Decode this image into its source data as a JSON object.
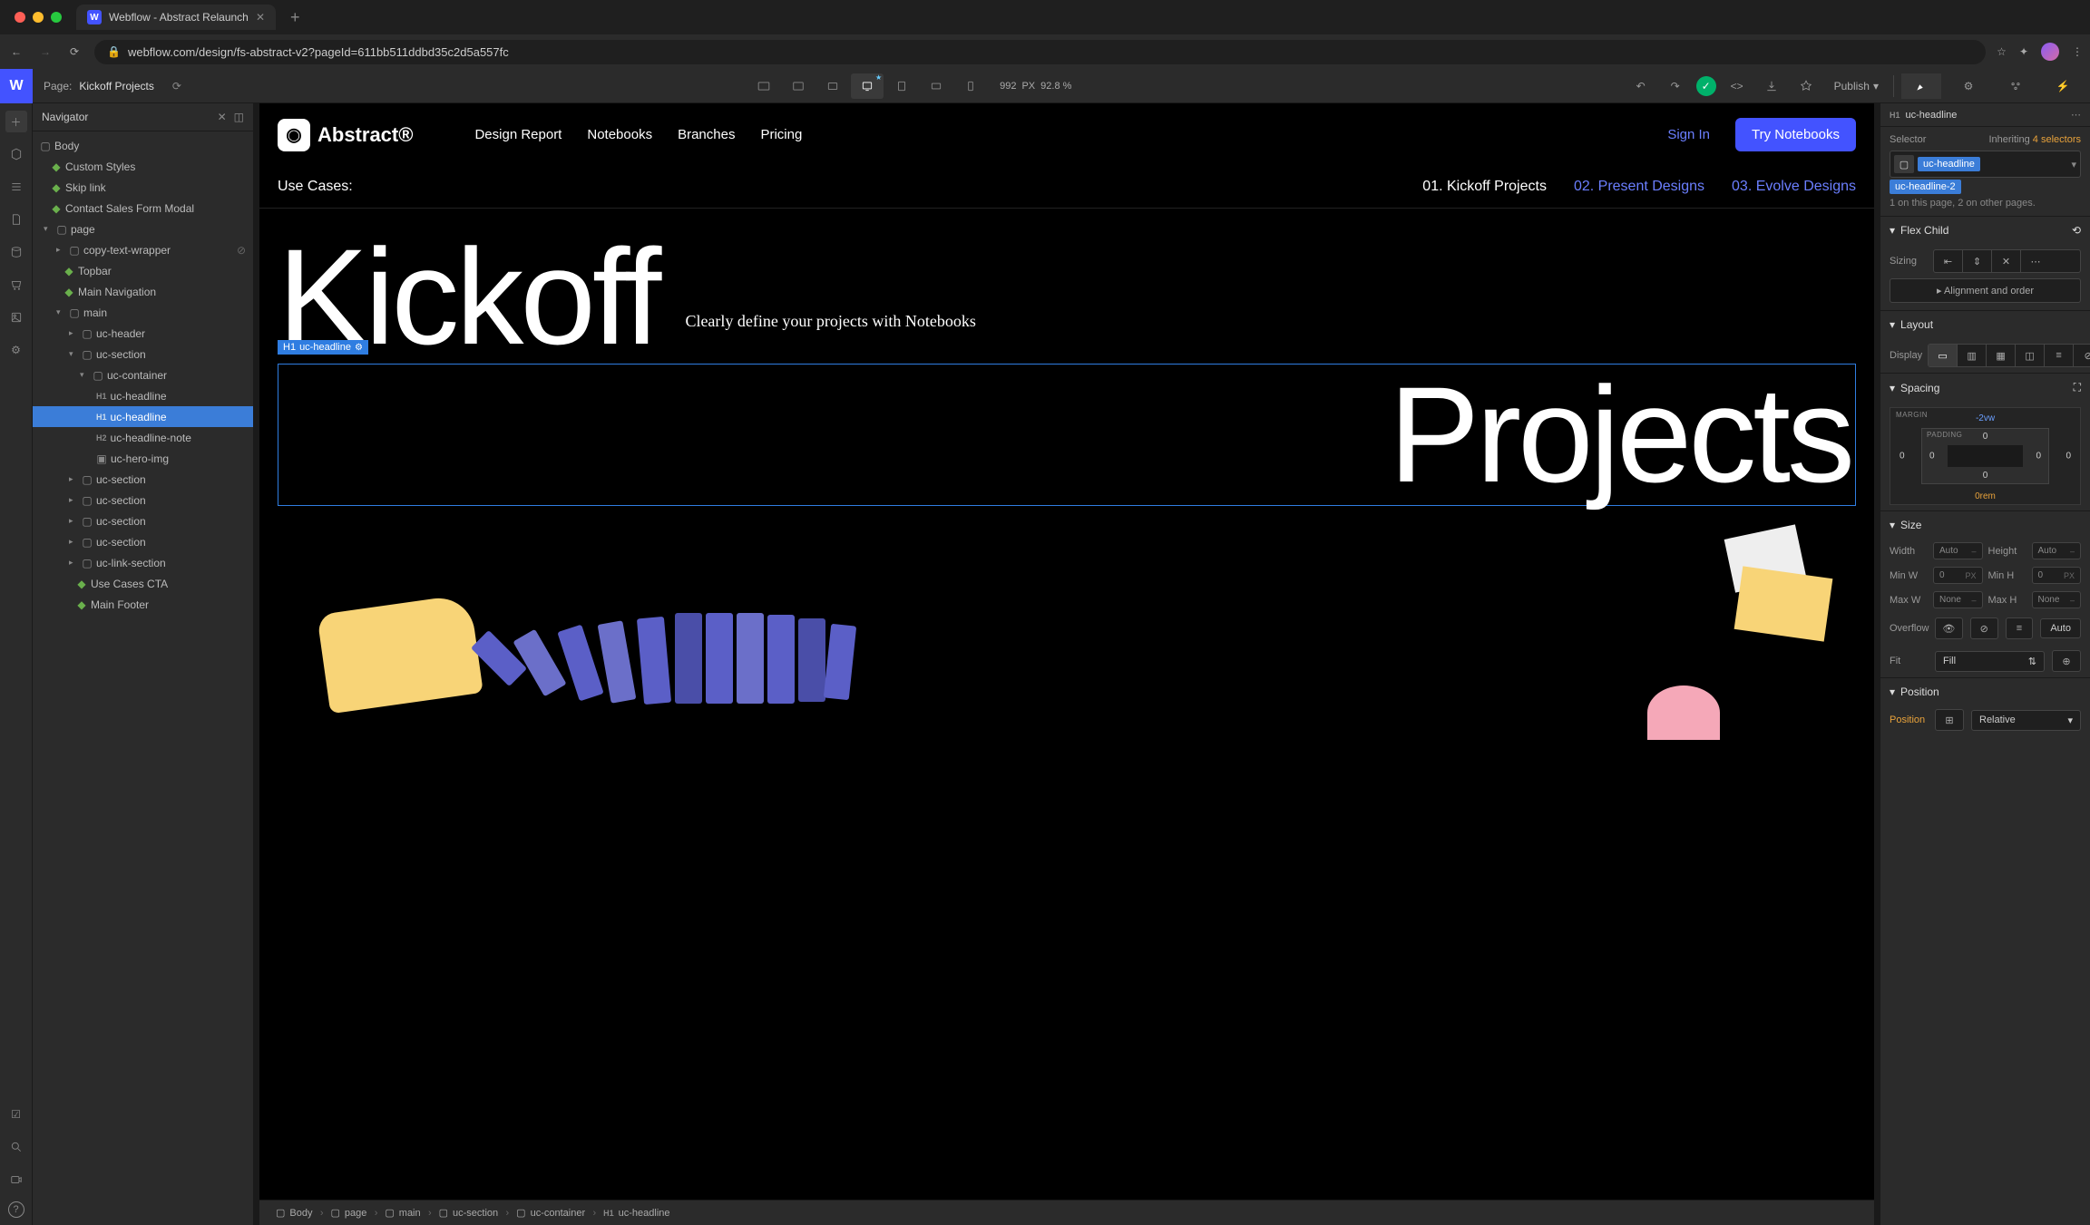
{
  "browser": {
    "tab_title": "Webflow - Abstract Relaunch",
    "url": "webflow.com/design/fs-abstract-v2?pageId=611bb511ddbd35c2d5a557fc"
  },
  "toolbar": {
    "page_prefix": "Page:",
    "page_name": "Kickoff Projects",
    "viewport_px": "992",
    "viewport_unit": "PX",
    "zoom": "92.8 %",
    "publish": "Publish"
  },
  "navigator": {
    "title": "Navigator",
    "tree": {
      "body": "Body",
      "custom_styles": "Custom Styles",
      "skip_link": "Skip link",
      "contact_modal": "Contact Sales Form Modal",
      "page": "page",
      "copy_text_wrapper": "copy-text-wrapper",
      "topbar": "Topbar",
      "main_nav": "Main Navigation",
      "main": "main",
      "uc_header": "uc-header",
      "uc_section": "uc-section",
      "uc_container": "uc-container",
      "uc_headline_1": "uc-headline",
      "uc_headline_2": "uc-headline",
      "uc_headline_note": "uc-headline-note",
      "uc_hero_img": "uc-hero-img",
      "uc_section_2": "uc-section",
      "uc_section_3": "uc-section",
      "uc_section_4": "uc-section",
      "uc_section_5": "uc-section",
      "uc_link_section": "uc-link-section",
      "use_cases_cta": "Use Cases CTA",
      "main_footer": "Main Footer"
    }
  },
  "preview": {
    "brand": "Abstract®",
    "nav": {
      "design_report": "Design Report",
      "notebooks": "Notebooks",
      "branches": "Branches",
      "pricing": "Pricing",
      "signin": "Sign In",
      "cta": "Try Notebooks"
    },
    "uc": {
      "label": "Use Cases:",
      "i1": "01. Kickoff Projects",
      "i2": "02. Present Designs",
      "i3": "03. Evolve Designs"
    },
    "headline1": "Kickoff",
    "subtitle": "Clearly define your projects with Notebooks",
    "headline2": "Projects",
    "sel_tag": "H1",
    "sel_name": "uc-headline"
  },
  "breadcrumb": {
    "body": "Body",
    "page": "page",
    "main": "main",
    "uc_section": "uc-section",
    "uc_container": "uc-container",
    "uc_headline": "uc-headline"
  },
  "style": {
    "tag_prefix": "H1",
    "element_name": "uc-headline",
    "selector_label": "Selector",
    "inheriting_text": "Inheriting",
    "inheriting_count": "4 selectors",
    "selector_tag1": "uc-headline",
    "selector_tag2": "uc-headline-2",
    "selector_note": "1 on this page, 2 on other pages.",
    "flex_child": "Flex Child",
    "sizing_label": "Sizing",
    "align_label": "Alignment and order",
    "layout": "Layout",
    "display_label": "Display",
    "spacing": "Spacing",
    "margin_label": "MARGIN",
    "padding_label": "PADDING",
    "margin_top": "-2vw",
    "margin_bottom": "0rem",
    "margin_left": "0",
    "margin_right": "0",
    "padding_top": "0",
    "padding_bottom": "0",
    "padding_left": "0",
    "padding_right": "0",
    "size": "Size",
    "width_label": "Width",
    "height_label": "Height",
    "minw_label": "Min W",
    "minh_label": "Min H",
    "maxw_label": "Max W",
    "maxh_label": "Max H",
    "auto": "Auto",
    "zero": "0",
    "px": "PX",
    "none": "None",
    "overflow_label": "Overflow",
    "overflow_auto": "Auto",
    "fit_label": "Fit",
    "fit_value": "Fill",
    "position": "Position",
    "position_label": "Position",
    "position_value": "Relative"
  }
}
